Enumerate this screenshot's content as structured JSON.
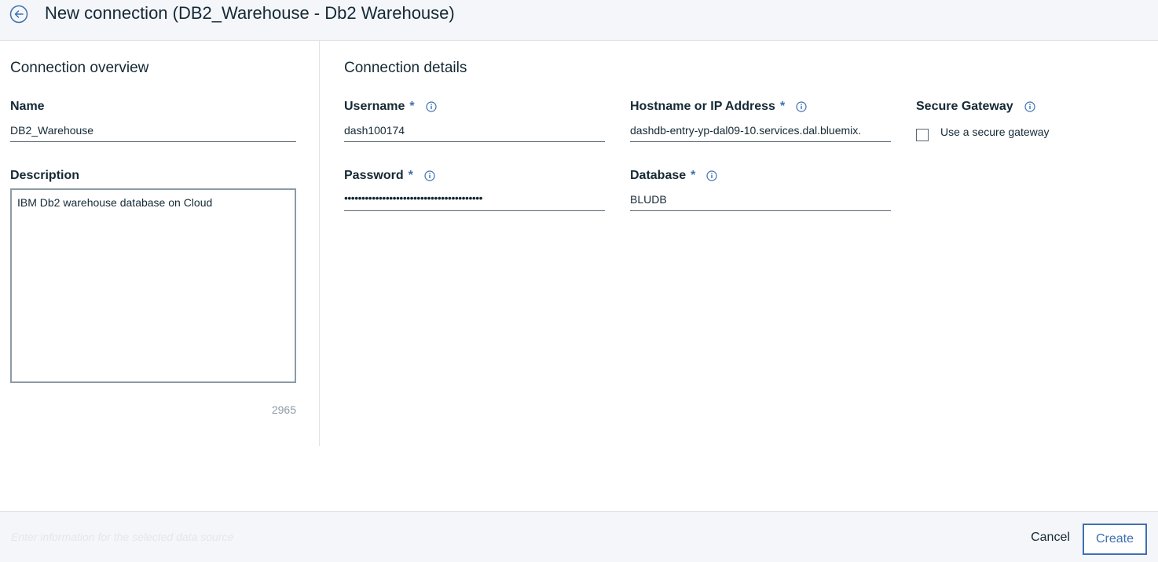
{
  "header": {
    "title": "New connection (DB2_Warehouse - Db2 Warehouse)"
  },
  "overview": {
    "section_title": "Connection overview",
    "name_label": "Name",
    "name_value": "DB2_Warehouse",
    "description_label": "Description",
    "description_value": "IBM Db2 warehouse database on Cloud",
    "char_count": "2965"
  },
  "details": {
    "section_title": "Connection details",
    "username": {
      "label": "Username",
      "required": "*",
      "value": "dash100174"
    },
    "hostname": {
      "label": "Hostname or IP Address",
      "required": "*",
      "value": "dashdb-entry-yp-dal09-10.services.dal.bluemix."
    },
    "secure_gateway": {
      "label": "Secure Gateway",
      "checkbox_label": "Use a secure gateway",
      "checked": false
    },
    "password": {
      "label": "Password",
      "required": "*",
      "value": "••••••••••••••••••••••••••••••••••••••••"
    },
    "database": {
      "label": "Database",
      "required": "*",
      "value": "BLUDB"
    }
  },
  "footer": {
    "hint": "Enter information for the selected data source",
    "cancel_label": "Cancel",
    "create_label": "Create"
  },
  "colors": {
    "accent": "#3d70b2",
    "text": "#152935",
    "header_bg": "#f4f6fa"
  },
  "icons": {
    "back": "arrow-left-circle-icon",
    "info": "info-icon"
  }
}
